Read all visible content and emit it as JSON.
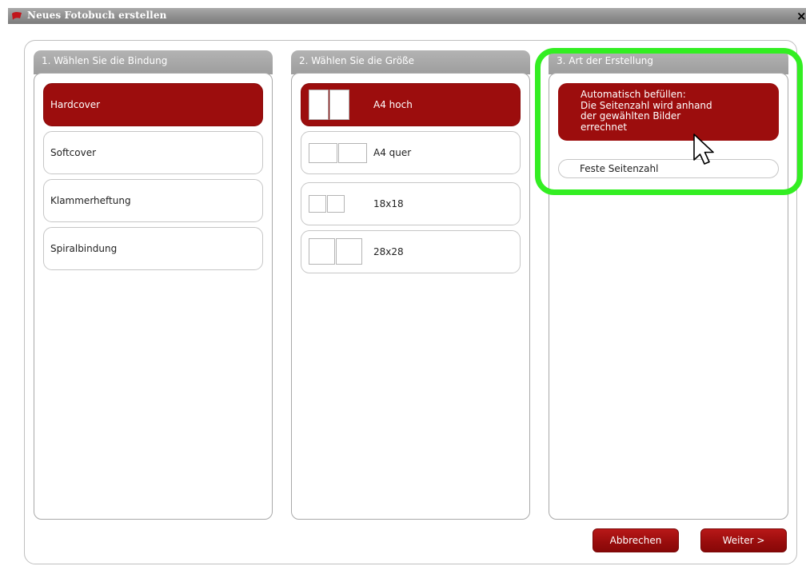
{
  "window": {
    "title": "Neues Fotobuch erstellen",
    "close_label": "×",
    "icon": "red-book-icon"
  },
  "binding": {
    "header": "1. Wählen Sie die Bindung",
    "options": [
      {
        "label": "Hardcover",
        "selected": true
      },
      {
        "label": "Softcover",
        "selected": false
      },
      {
        "label": "Klammerheftung",
        "selected": false
      },
      {
        "label": "Spiralbindung",
        "selected": false
      }
    ]
  },
  "size": {
    "header": "2. Wählen Sie die Größe",
    "options": [
      {
        "label": "A4 hoch",
        "selected": true,
        "icon": "portrait-pages-icon"
      },
      {
        "label": "A4 quer",
        "selected": false,
        "icon": "landscape-pages-icon"
      },
      {
        "label": "18x18",
        "selected": false,
        "icon": "square-pages-small-icon"
      },
      {
        "label": "28x28",
        "selected": false,
        "icon": "square-pages-large-icon"
      }
    ]
  },
  "creation": {
    "header": "3. Art der Erstellung",
    "auto_label": "Automatisch befüllen:\nDie Seitenzahl wird anhand\nder gewählten Bilder\nerrechnet",
    "fixed_label": "Feste Seitenzahl",
    "selected": "auto"
  },
  "buttons": {
    "cancel": "Abbrechen",
    "next": "Weiter >"
  },
  "colors": {
    "selected_red": "#9c0d0d",
    "highlight_green": "#33ee22",
    "header_gray": "#a8a8a8"
  }
}
